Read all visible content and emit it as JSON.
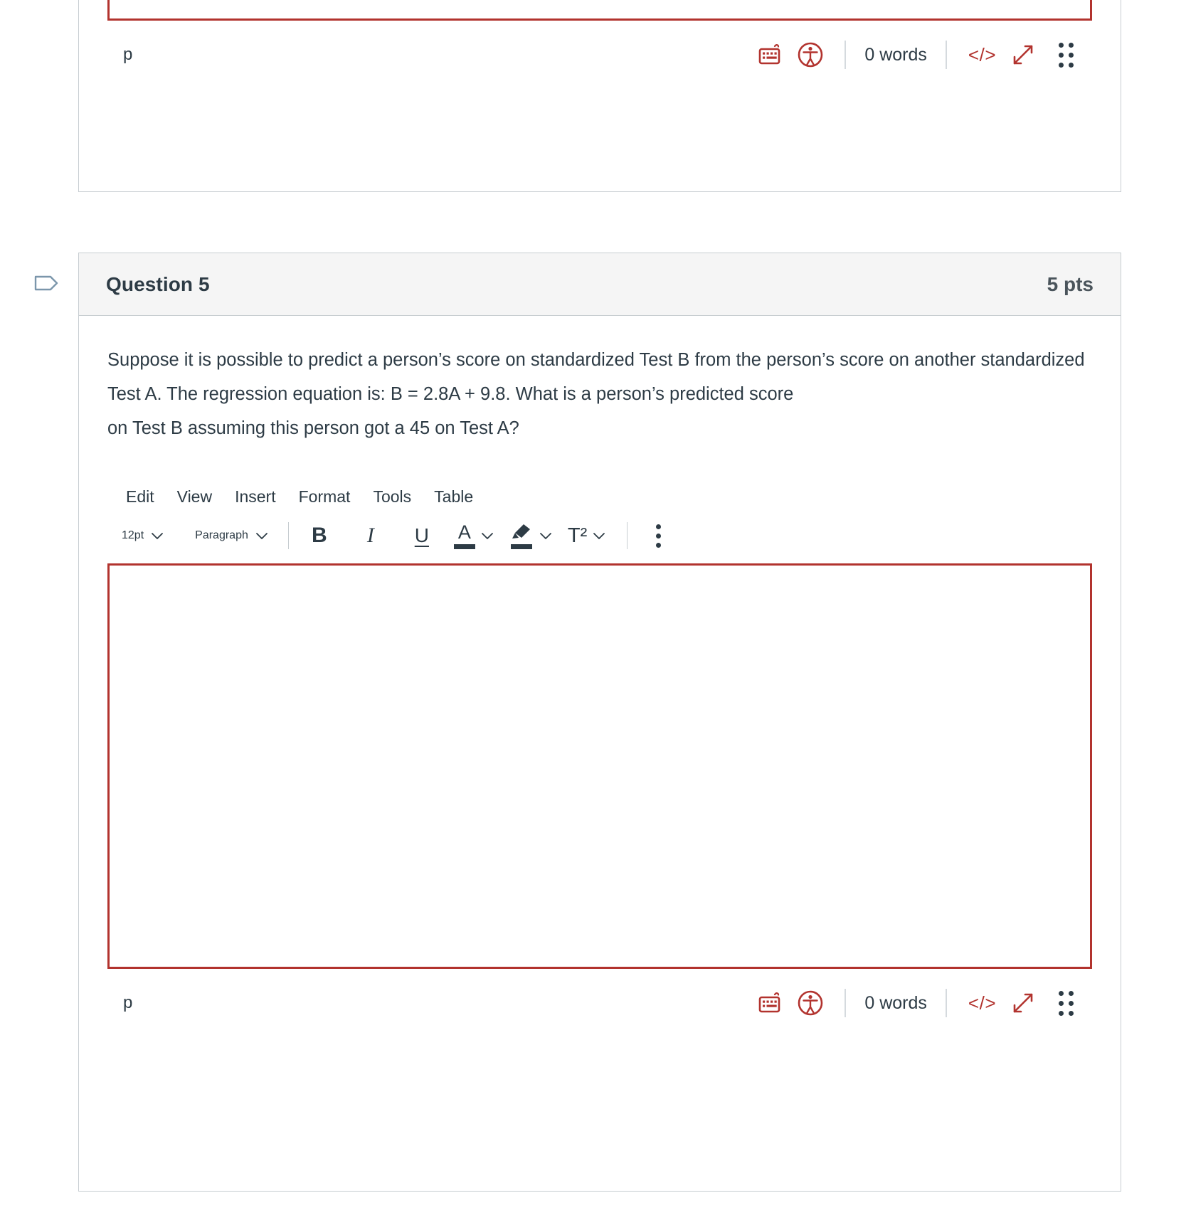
{
  "previous_question_editor": {
    "status": {
      "path": "p",
      "word_count": "0 words",
      "keyboard_icon": "keyboard-shortcuts-icon",
      "accessibility_icon": "accessibility-checker-icon",
      "html_editor_label": "</>",
      "resize_icon": "resize-handle-icon",
      "drag_icon": "drag-handle-icon"
    }
  },
  "question": {
    "flag_icon": "bookmark-flag-icon",
    "title": "Question 5",
    "points": "5 pts",
    "prompt_line_1": "Suppose it is possible to predict a person’s score on standardized Test B from the person’s score on another standardized Test A. The regression equation is: B = 2.8A + 9.8. What is a person’s predicted score",
    "prompt_line_2": "on Test B assuming this person got a 45 on Test A?"
  },
  "editor": {
    "menubar": [
      {
        "label": "Edit"
      },
      {
        "label": "View"
      },
      {
        "label": "Insert"
      },
      {
        "label": "Format"
      },
      {
        "label": "Tools"
      },
      {
        "label": "Table"
      }
    ],
    "toolbar": {
      "font_size": "12pt",
      "block_format": "Paragraph",
      "bold_label": "B",
      "italic_label": "I",
      "underline_label": "U",
      "text_color_label": "A",
      "highlighter_icon": "highlighter-pen-icon",
      "superscript_label": "T²",
      "more_options_icon": "more-options-kebab-icon"
    },
    "content_value": "",
    "status": {
      "path": "p",
      "word_count": "0 words",
      "keyboard_icon": "keyboard-shortcuts-icon",
      "accessibility_icon": "accessibility-checker-icon",
      "html_editor_label": "</>",
      "resize_icon": "resize-handle-icon",
      "drag_icon": "drag-handle-icon"
    }
  },
  "colors": {
    "brand_red": "#b2332e",
    "text": "#2d3b45",
    "header_bg": "#f5f5f5",
    "border": "#c7cdd1"
  }
}
